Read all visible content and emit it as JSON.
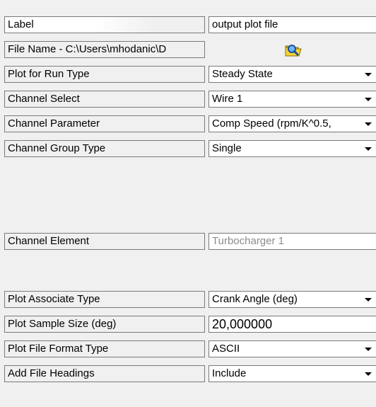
{
  "rows": [
    {
      "label": "Label",
      "value": "output plot file"
    },
    {
      "label": "File Name - C:\\Users\\mhodanic\\D",
      "value": ""
    },
    {
      "label": "Plot for Run Type",
      "value": "Steady State"
    },
    {
      "label": "Channel Select",
      "value": "Wire 1"
    },
    {
      "label": "Channel Parameter",
      "value": "Comp Speed (rpm/K^0.5,"
    },
    {
      "label": "Channel Group Type",
      "value": "Single"
    },
    {
      "label": "Channel Element",
      "value": "Turbocharger 1"
    },
    {
      "label": "Plot Associate Type",
      "value": "Crank Angle (deg)"
    },
    {
      "label": "Plot Sample Size (deg)",
      "value": "20,000000"
    },
    {
      "label": "Plot File Format Type",
      "value": "ASCII"
    },
    {
      "label": "Add File Headings",
      "value": "Include"
    }
  ],
  "icons": {
    "file_browse": "folder-search-icon"
  }
}
